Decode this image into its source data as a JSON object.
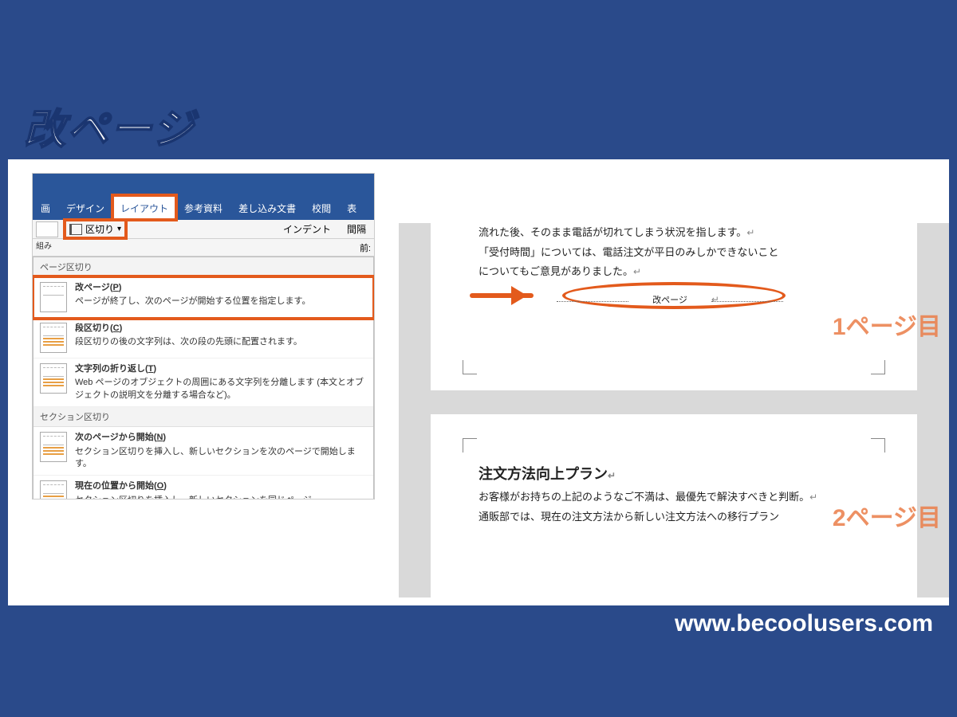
{
  "page_title": "改ページ",
  "url": "www.becoolusers.com",
  "ribbon": {
    "tabs": [
      "画",
      "デザイン",
      "レイアウト",
      "参考資料",
      "差し込み文書",
      "校閲",
      "表"
    ],
    "active_tab": "レイアウト",
    "break_button": "区切り",
    "toolbar": {
      "indent": "インデント",
      "spacing": "間隔",
      "kumi": "組み",
      "before": "前:"
    },
    "menu": {
      "group1": "ページ区切り",
      "item1": {
        "title": "改ページ(",
        "key": "P",
        "title2": ")",
        "desc": "ページが終了し、次のページが開始する位置を指定します。"
      },
      "item2": {
        "title": "段区切り(",
        "key": "C",
        "title2": ")",
        "desc": "段区切りの後の文字列は、次の段の先頭に配置されます。"
      },
      "item3": {
        "title": "文字列の折り返し(",
        "key": "T",
        "title2": ")",
        "desc": "Web ページのオブジェクトの周囲にある文字列を分離します (本文とオブジェクトの説明文を分離する場合など)。"
      },
      "group2": "セクション区切り",
      "item4": {
        "title": "次のページから開始(",
        "key": "N",
        "title2": ")",
        "desc": "セクション区切りを挿入し、新しいセクションを次のページで開始します。"
      },
      "item5": {
        "title": "現在の位置から開始(",
        "key": "O",
        "title2": ")",
        "desc": "セクション区切りを挿入し、新しいセクションを同じページ"
      }
    }
  },
  "doc": {
    "p1_l1": "流れた後、そのまま電話が切れてしまう状況を指します。",
    "p1_l2": "「受付時間」については、電話注文が平日のみしかできないこと",
    "p1_l3": "についてもご意見がありました。",
    "break_label": "改ページ",
    "p2_title": "注文方法向上プラン",
    "p2_l1": "お客様がお持ちの上記のようなご不満は、最優先で解決すべきと判断。",
    "p2_l2": "通販部では、現在の注文方法から新しい注文方法への移行プラン"
  },
  "annotation": {
    "page1": "1ページ目",
    "page2": "2ページ目"
  }
}
